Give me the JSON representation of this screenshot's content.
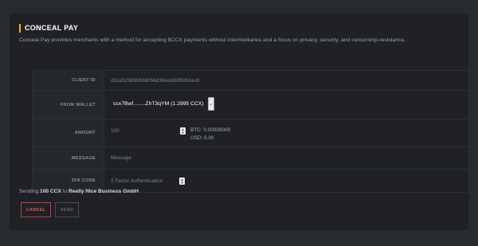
{
  "header": {
    "title": "CONCEAL PAY",
    "description": "Conceal.Pay provides merchants with a method for accepting $CCX payments without intermediaries and a focus on privacy, security, and censorship-resistance."
  },
  "form": {
    "client_id": {
      "label": "CLIENT ID",
      "value": "d52a525899638056d36eeb83f5061ec6"
    },
    "from_wallet": {
      "label": "FROM WALLET",
      "value": "ccx7Bwf........ZhT3qYM (1.2995 CCX)"
    },
    "amount": {
      "label": "AMOUNT",
      "placeholder": "100",
      "btc_line": "BTC: 0.00000000",
      "usd_line": "USD: 0.00"
    },
    "message": {
      "label": "MESSAGE",
      "placeholder": "Message"
    },
    "twofa": {
      "label": "2FA CODE",
      "placeholder": "2 Factor Authentication"
    }
  },
  "summary": {
    "prefix": "Sending ",
    "amount": "100 CCX",
    "middle": " to ",
    "recipient": "Really Nice Business GmbH"
  },
  "actions": {
    "cancel_label": "CANCEL",
    "send_label": "SEND"
  },
  "colors": {
    "accent": "#f2b01e",
    "cancel": "#c33a3f",
    "background": "#1f2126"
  },
  "icons": {
    "wallet_dropdown": "chevron-down-icon",
    "amount_stepper": "stepper-icon",
    "twofa_stepper": "stepper-icon"
  }
}
